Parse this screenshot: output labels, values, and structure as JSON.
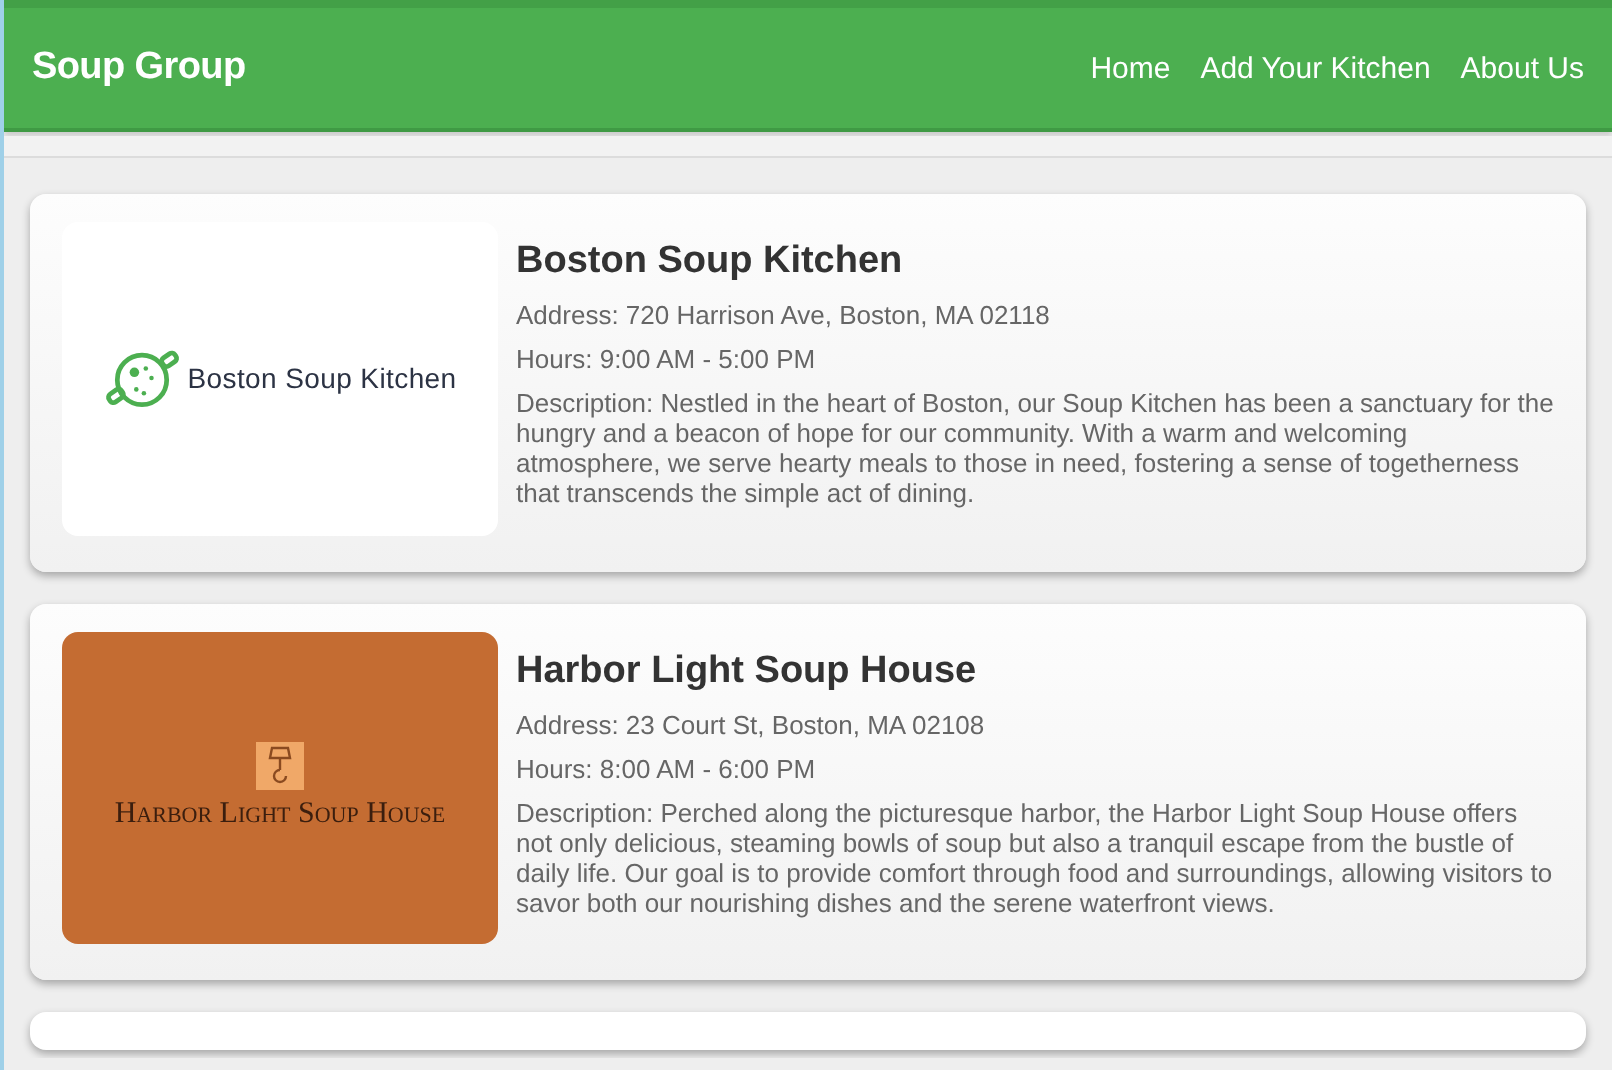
{
  "header": {
    "brand": "Soup Group",
    "nav": [
      {
        "label": "Home"
      },
      {
        "label": "Add Your Kitchen"
      },
      {
        "label": "About Us"
      }
    ]
  },
  "kitchens": [
    {
      "kind": "pot",
      "logo_text": "Boston Soup Kitchen",
      "name": "Boston Soup Kitchen",
      "address": "Address: 720 Harrison Ave, Boston, MA 02118",
      "hours": "Hours: 9:00 AM - 5:00 PM",
      "description": "Description: Nestled in the heart of Boston, our Soup Kitchen has been a sanctuary for the hungry and a beacon of hope for our community. With a warm and welcoming atmosphere, we serve hearty meals to those in need, fostering a sense of togetherness that transcends the simple act of dining."
    },
    {
      "kind": "lamp",
      "logo_text": "Harbor Light Soup House",
      "name": "Harbor Light Soup House",
      "address": "Address: 23 Court St, Boston, MA 02108",
      "hours": "Hours: 8:00 AM - 6:00 PM",
      "description": "Description: Perched along the picturesque harbor, the Harbor Light Soup House offers not only delicious, steaming bowls of soup but also a tranquil escape from the bustle of daily life. Our goal is to provide comfort through food and surroundings, allowing visitors to savor both our nourishing dishes and the serene waterfront views."
    }
  ]
}
